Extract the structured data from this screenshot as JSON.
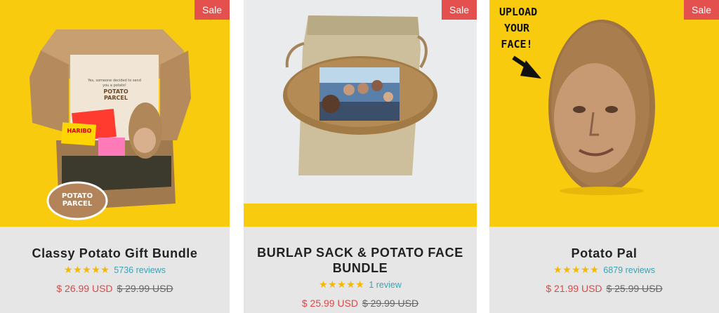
{
  "products": [
    {
      "badge": "Sale",
      "title": "Classy Potato Gift Bundle",
      "stars": "★★★★★",
      "rating": 5,
      "reviews": "5736 reviews",
      "price_sale": "$ 26.99 USD",
      "price_original": "$ 29.99 USD",
      "image_text": {
        "box_note": "Yes, someone decided to send you a potato!",
        "box_logo": "POTATO PARCEL",
        "candy": "HARIBO",
        "sticker": "POTATO PARCEL"
      }
    },
    {
      "badge": "Sale",
      "title": "BURLAP SACK & POTATO FACE BUNDLE",
      "stars": "★★★★★",
      "rating": 5,
      "reviews": "1 review",
      "price_sale": "$ 25.99 USD",
      "price_original": "$ 29.99 USD"
    },
    {
      "badge": "Sale",
      "title": "Potato Pal",
      "stars": "★★★★★",
      "rating": 5,
      "reviews": "6879 reviews",
      "price_sale": "$ 21.99 USD",
      "price_original": "$ 25.99 USD",
      "image_text": {
        "callout": "UPLOAD YOUR FACE!"
      }
    }
  ],
  "colors": {
    "image_background": "#f8cb0f",
    "badge": "#e4504d",
    "star": "#f5b800",
    "review_link": "#3aa3b2",
    "sale_price": "#d84a46"
  }
}
